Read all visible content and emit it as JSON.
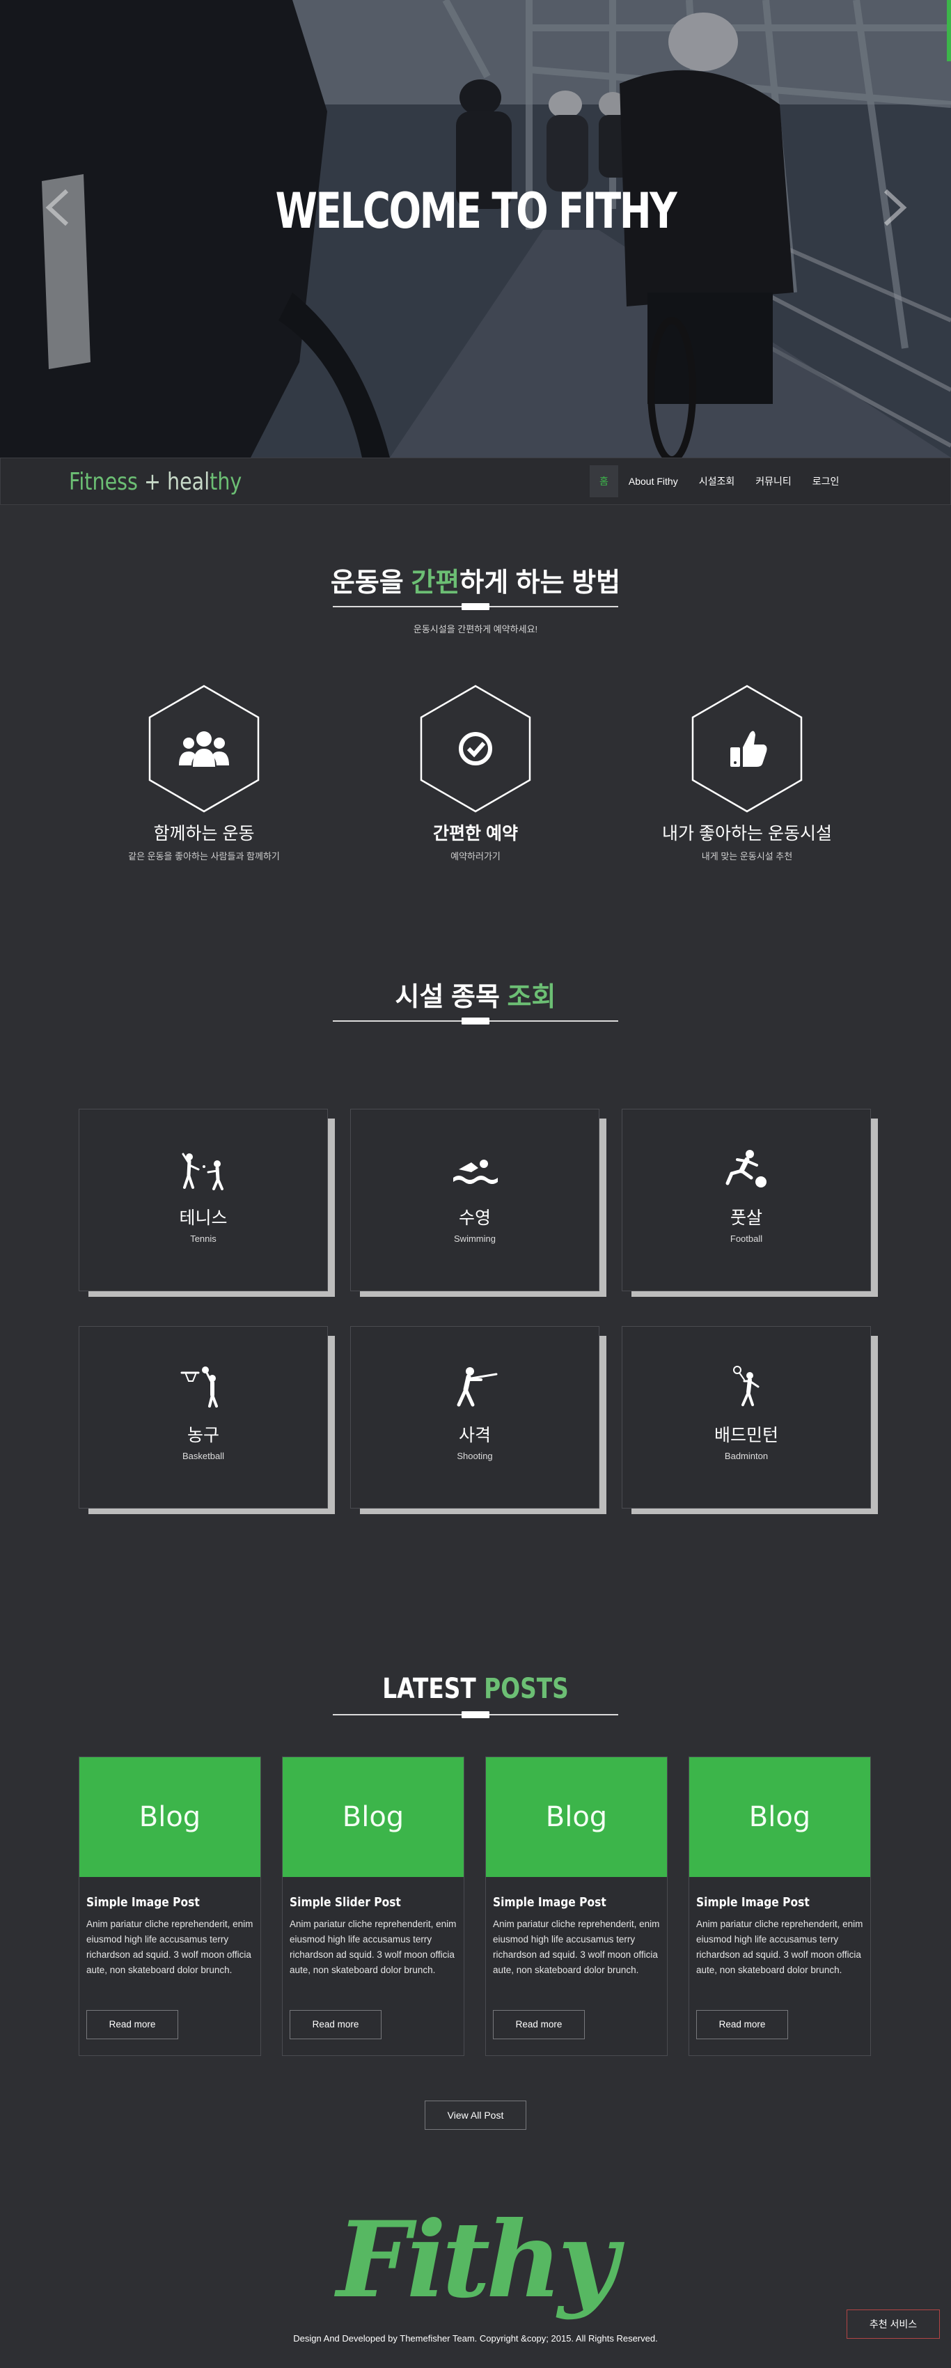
{
  "hero": {
    "title": "WELCOME TO FITHY"
  },
  "nav": {
    "brand_part1": "Fitness",
    "brand_plus": " + ",
    "brand_part2": "heal",
    "brand_part3": "thy",
    "items": [
      {
        "label": "홈",
        "active": true
      },
      {
        "label": "About Fithy"
      },
      {
        "label": "시설조회"
      },
      {
        "label": "커뮤니티"
      },
      {
        "label": "로그인"
      }
    ]
  },
  "how": {
    "title_pre": "운동을 ",
    "title_hl": "간편",
    "title_post": "하게 하는 방법",
    "subtitle": "운동시설을 간편하게 예약하세요!",
    "features": [
      {
        "icon": "users-icon",
        "title": "함께하는 운동",
        "desc": "같은 운동을 좋아하는 사람들과 함께하기"
      },
      {
        "icon": "check-circle-icon",
        "title": "간편한 예약",
        "desc": "예약하러가기"
      },
      {
        "icon": "thumbs-up-icon",
        "title": "내가 좋아하는 운동시설",
        "desc": "내게 맞는 운동시설 추천"
      }
    ]
  },
  "sports": {
    "title_pre": "시설 종목 ",
    "title_hl": "조회",
    "items": [
      {
        "icon": "tennis-icon",
        "title": "테니스",
        "sub": "Tennis"
      },
      {
        "icon": "swimming-icon",
        "title": "수영",
        "sub": "Swimming"
      },
      {
        "icon": "football-icon",
        "title": "풋살",
        "sub": "Football"
      },
      {
        "icon": "basketball-icon",
        "title": "농구",
        "sub": "Basketball"
      },
      {
        "icon": "shooting-icon",
        "title": "사격",
        "sub": "Shooting"
      },
      {
        "icon": "badminton-icon",
        "title": "배드민턴",
        "sub": "Badminton"
      }
    ]
  },
  "posts": {
    "title_pre": "LATEST ",
    "title_hl": "POSTS",
    "items": [
      {
        "thumb": "Blog",
        "title": "Simple Image Post",
        "body": "Anim pariatur cliche reprehenderit, enim eiusmod high life accusamus terry richardson ad squid. 3 wolf moon officia aute, non skateboard dolor brunch.",
        "button": "Read more"
      },
      {
        "thumb": "Blog",
        "title": "Simple Slider Post",
        "body": "Anim pariatur cliche reprehenderit, enim eiusmod high life accusamus terry richardson ad squid. 3 wolf moon officia aute, non skateboard dolor brunch.",
        "button": "Read more"
      },
      {
        "thumb": "Blog",
        "title": "Simple Image Post",
        "body": "Anim pariatur cliche reprehenderit, enim eiusmod high life accusamus terry richardson ad squid. 3 wolf moon officia aute, non skateboard dolor brunch.",
        "button": "Read more"
      },
      {
        "thumb": "Blog",
        "title": "Simple Image Post",
        "body": "Anim pariatur cliche reprehenderit, enim eiusmod high life accusamus terry richardson ad squid. 3 wolf moon officia aute, non skateboard dolor brunch.",
        "button": "Read more"
      }
    ],
    "view_all": "View All Post"
  },
  "footer": {
    "logo": "Fithy",
    "copyright": "Design And Developed by Themefisher Team. Copyright &copy; 2015. All Rights Reserved.",
    "recommend": "추천 서비스"
  },
  "colors": {
    "accent": "#3cb54a",
    "background": "#2e2f33",
    "logo": "#57b862"
  }
}
